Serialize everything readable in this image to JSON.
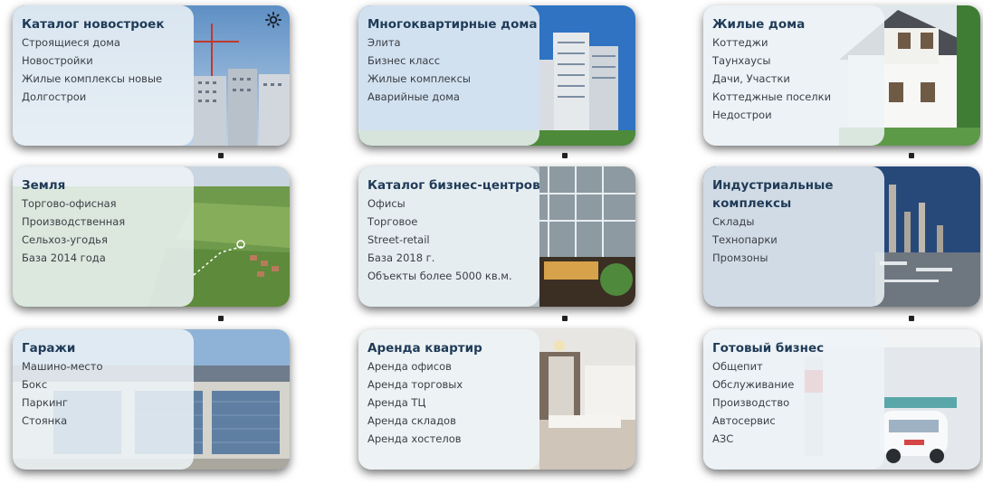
{
  "cards": [
    {
      "title": "Каталог новостроек",
      "items": [
        "Строящиеся дома",
        "Новостройки",
        "Жилые комплексы новые",
        "Долгострои"
      ]
    },
    {
      "title": "Многоквартирные дома",
      "items": [
        "Элита",
        "Бизнес класс",
        "Жилые комплексы",
        "Аварийные дома"
      ]
    },
    {
      "title": "Жилые дома",
      "items": [
        "Коттеджи",
        "Таунхаусы",
        "Дачи, Участки",
        "Коттеджные поселки",
        "Недострои"
      ]
    },
    {
      "title": "Земля",
      "items": [
        "Торгово-офисная",
        "Производственная",
        "Сельхоз-угодья",
        "База 2014 года"
      ]
    },
    {
      "title": "Каталог бизнес-центров",
      "items": [
        "Офисы",
        "Торговое",
        "Street-retail",
        "База 2018 г.",
        "Объекты более 5000 кв.м."
      ]
    },
    {
      "title": "Индустриальные комплексы",
      "items": [
        "Склады",
        "Технопарки",
        "Промзоны"
      ]
    },
    {
      "title": "Гаражи",
      "items": [
        "Машино-место",
        "Бокс",
        "Паркинг",
        "Стоянка"
      ]
    },
    {
      "title": "Аренда квартир",
      "items": [
        "Аренда офисов",
        "Аренда торговых",
        "Аренда ТЦ",
        "Аренда складов",
        "Аренда хостелов"
      ]
    },
    {
      "title": "Готовый бизнес",
      "items": [
        "Общепит",
        "Обслуживание",
        "Производство",
        "Автосервис",
        "АЗС"
      ]
    }
  ],
  "icons": {
    "settings": "gear-icon"
  }
}
